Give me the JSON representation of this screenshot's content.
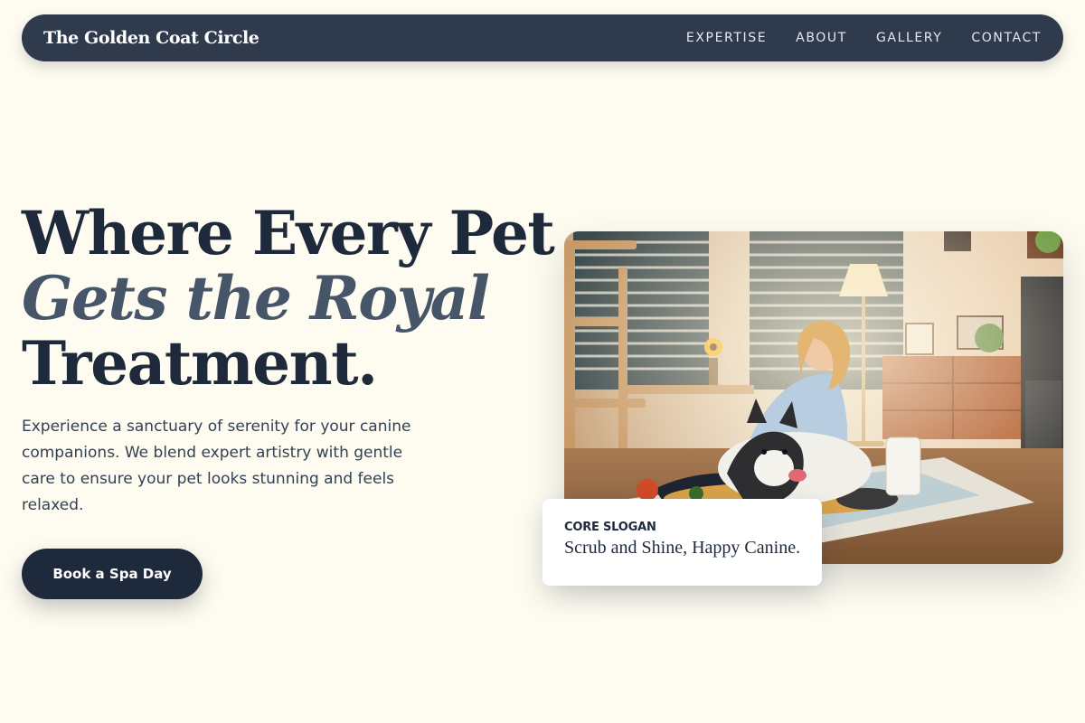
{
  "brand": {
    "name": "The Golden Coat Circle"
  },
  "nav": {
    "items": [
      {
        "label": "EXPERTISE"
      },
      {
        "label": "ABOUT"
      },
      {
        "label": "GALLERY"
      },
      {
        "label": "CONTACT"
      }
    ]
  },
  "hero": {
    "headline_line1": "Where Every Pet",
    "headline_line2": "Gets the Royal",
    "headline_line3": "Treatment.",
    "lead": "Experience a sanctuary of serenity for your canine companions. We blend expert artistry with gentle care to ensure your pet looks stunning and feels relaxed.",
    "cta_label": "Book a Spa Day"
  },
  "slogan": {
    "label": "CORE SLOGAN",
    "text": "Scrub and Shine, Happy Canine."
  },
  "colors": {
    "page_bg": "#fefcf0",
    "nav_bg": "#2f3b4c",
    "primary": "#1e293b",
    "accent_slate": "#475569"
  }
}
